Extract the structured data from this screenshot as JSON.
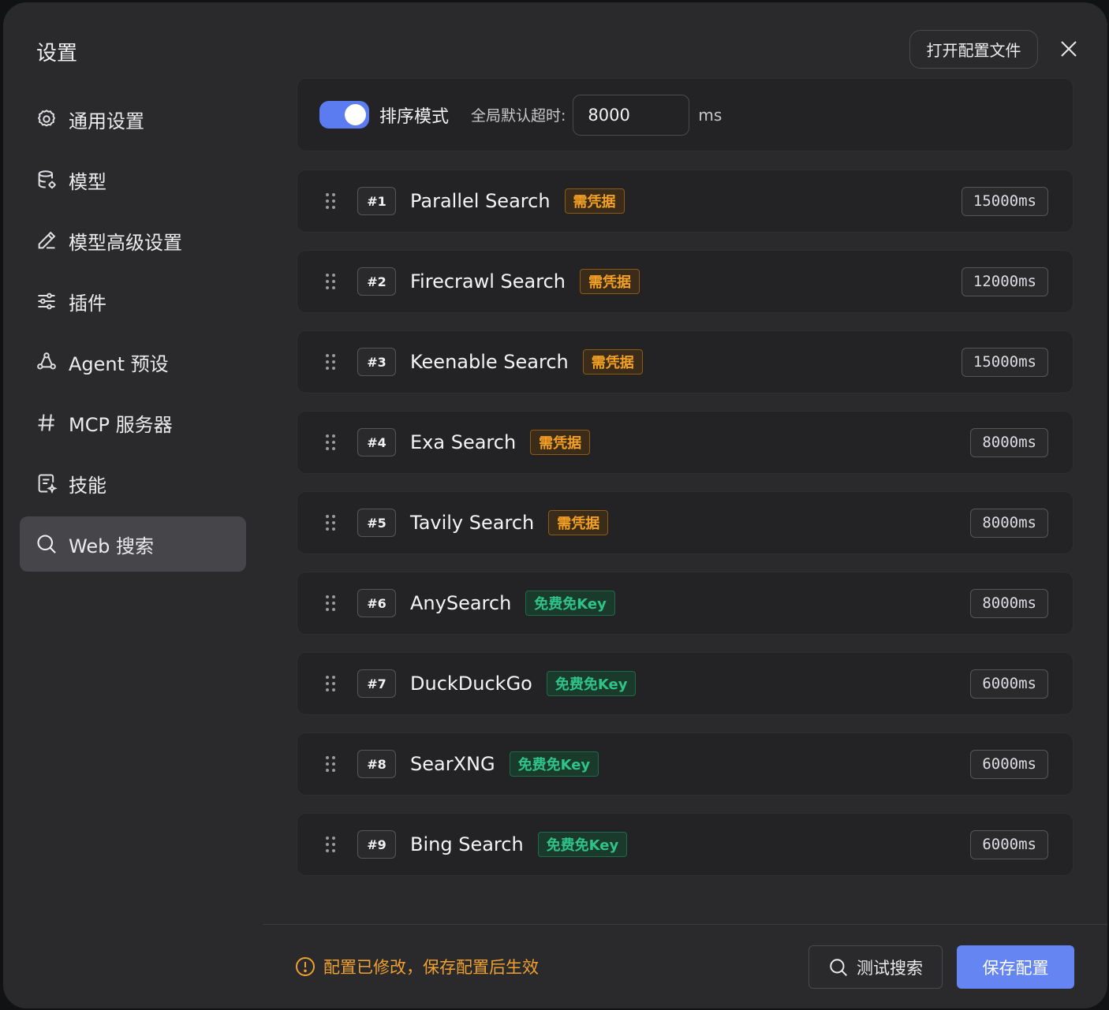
{
  "window": {
    "title": "设置"
  },
  "sidebar": {
    "items": [
      {
        "label": "通用设置",
        "icon": "gear-icon",
        "active": false
      },
      {
        "label": "模型",
        "icon": "database-icon",
        "active": false
      },
      {
        "label": "模型高级设置",
        "icon": "pencil-icon",
        "active": false
      },
      {
        "label": "插件",
        "icon": "sliders-icon",
        "active": false
      },
      {
        "label": "Agent 预设",
        "icon": "agent-icon",
        "active": false
      },
      {
        "label": "MCP 服务器",
        "icon": "hash-icon",
        "active": false
      },
      {
        "label": "技能",
        "icon": "skill-icon",
        "active": false
      },
      {
        "label": "Web 搜索",
        "icon": "search-icon",
        "active": true
      }
    ]
  },
  "header": {
    "open_config_label": "打开配置文件"
  },
  "settings": {
    "sort_mode_label": "排序模式",
    "sort_mode_on": true,
    "timeout_label": "全局默认超时:",
    "timeout_value": "8000",
    "timeout_unit": "ms"
  },
  "providers": [
    {
      "rank": "#1",
      "name": "Parallel Search",
      "badge": "需凭据",
      "badge_type": "credential",
      "timeout": "15000ms"
    },
    {
      "rank": "#2",
      "name": "Firecrawl Search",
      "badge": "需凭据",
      "badge_type": "credential",
      "timeout": "12000ms"
    },
    {
      "rank": "#3",
      "name": "Keenable Search",
      "badge": "需凭据",
      "badge_type": "credential",
      "timeout": "15000ms"
    },
    {
      "rank": "#4",
      "name": "Exa Search",
      "badge": "需凭据",
      "badge_type": "credential",
      "timeout": "8000ms"
    },
    {
      "rank": "#5",
      "name": "Tavily Search",
      "badge": "需凭据",
      "badge_type": "credential",
      "timeout": "8000ms"
    },
    {
      "rank": "#6",
      "name": "AnySearch",
      "badge": "免费免Key",
      "badge_type": "free",
      "timeout": "8000ms"
    },
    {
      "rank": "#7",
      "name": "DuckDuckGo",
      "badge": "免费免Key",
      "badge_type": "free",
      "timeout": "6000ms"
    },
    {
      "rank": "#8",
      "name": "SearXNG",
      "badge": "免费免Key",
      "badge_type": "free",
      "timeout": "6000ms"
    },
    {
      "rank": "#9",
      "name": "Bing Search",
      "badge": "免费免Key",
      "badge_type": "free",
      "timeout": "6000ms"
    }
  ],
  "footer": {
    "notice": "配置已修改，保存配置后生效",
    "test_label": "测试搜索",
    "save_label": "保存配置"
  },
  "colors": {
    "accent": "#5b7cf0",
    "credential_badge": "#f4a024",
    "free_badge": "#2ec488",
    "warning": "#f0a030"
  }
}
